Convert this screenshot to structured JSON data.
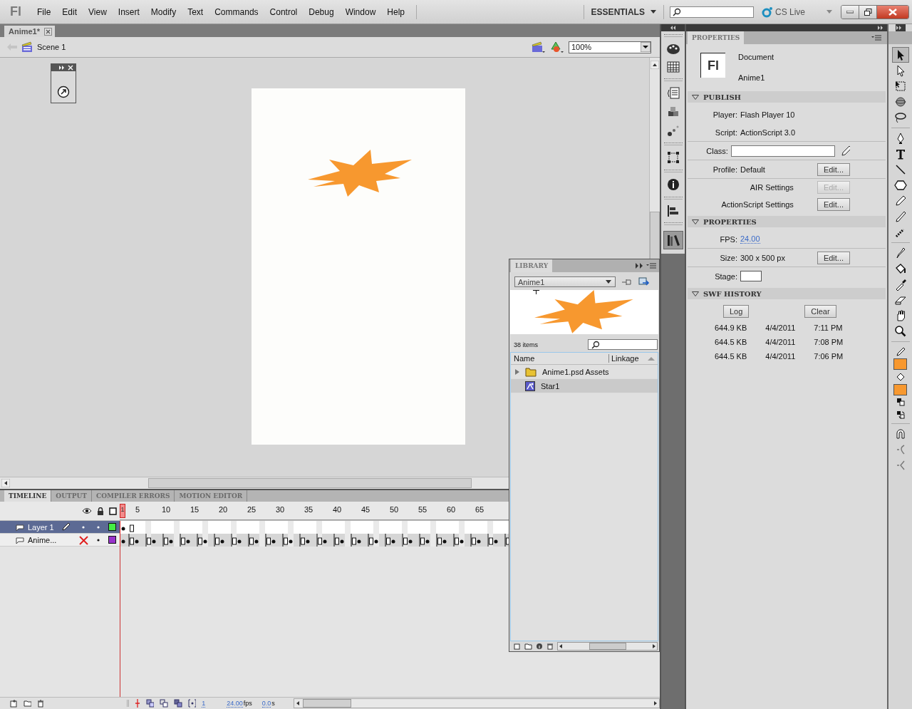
{
  "app_logo": "Fl",
  "document_icon": "Fl",
  "menu": [
    "File",
    "Edit",
    "View",
    "Insert",
    "Modify",
    "Text",
    "Commands",
    "Control",
    "Debug",
    "Window",
    "Help"
  ],
  "workspace": "ESSENTIALS",
  "cs_live": "CS Live",
  "document_tab": {
    "title": "Anime1*"
  },
  "edit_bar": {
    "scene": "Scene 1",
    "zoom": "100%"
  },
  "library": {
    "title": "LIBRARY",
    "document": "Anime1",
    "count": "38 items",
    "columns": [
      "Name",
      "Linkage"
    ],
    "items": [
      {
        "name": "Anime1.psd Assets",
        "kind": "folder",
        "selected": false
      },
      {
        "name": "Star1",
        "kind": "graphic",
        "selected": true
      }
    ]
  },
  "timeline": {
    "tabs": [
      {
        "label": "TIMELINE",
        "selected": true
      },
      {
        "label": "OUTPUT",
        "selected": false
      },
      {
        "label": "COMPILER ERRORS",
        "selected": false
      },
      {
        "label": "MOTION EDITOR",
        "selected": false
      }
    ],
    "playhead": "1",
    "frame_numbers": [
      "5",
      "10",
      "15",
      "20",
      "25",
      "30",
      "35",
      "40",
      "45",
      "50",
      "55",
      "60",
      "65"
    ],
    "layers": [
      {
        "name": "Layer 1",
        "selected": true,
        "visible": true,
        "color": "#44ee44",
        "kind": "single"
      },
      {
        "name": "Anime...",
        "selected": false,
        "visible": false,
        "color": "#9933cc",
        "kind": "sequence"
      }
    ],
    "status": {
      "frame": "1",
      "fps": "24.00",
      "fps_unit": "fps",
      "time": "0.0",
      "time_unit": "s"
    }
  },
  "properties": {
    "title": "PROPERTIES",
    "doc_kind": "Document",
    "doc_name": "Anime1",
    "publish": {
      "title": "PUBLISH",
      "player_label": "Player:",
      "player": "Flash Player 10",
      "script_label": "Script:",
      "script": "ActionScript 3.0",
      "class_label": "Class:",
      "profile_label": "Profile:",
      "profile": "Default",
      "profile_button": "Edit...",
      "air_label": "AIR Settings",
      "air_button": "Edit...",
      "air_disabled": true,
      "as_label": "ActionScript Settings",
      "as_button": "Edit..."
    },
    "props": {
      "title": "PROPERTIES",
      "fps_label": "FPS:",
      "fps": "24.00",
      "size_label": "Size:",
      "size": "300 x 500 px",
      "size_button": "Edit...",
      "stage_label": "Stage:"
    },
    "history": {
      "title": "SWF HISTORY",
      "log": "Log",
      "clear": "Clear",
      "rows": [
        [
          "644.9 KB",
          "4/4/2011",
          "7:11 PM"
        ],
        [
          "644.5 KB",
          "4/4/2011",
          "7:08 PM"
        ],
        [
          "644.5 KB",
          "4/4/2011",
          "7:06 PM"
        ]
      ]
    }
  },
  "tools": {
    "stroke": {
      "color": "#f7982f"
    },
    "fill": {
      "color": "#f7982f"
    }
  }
}
